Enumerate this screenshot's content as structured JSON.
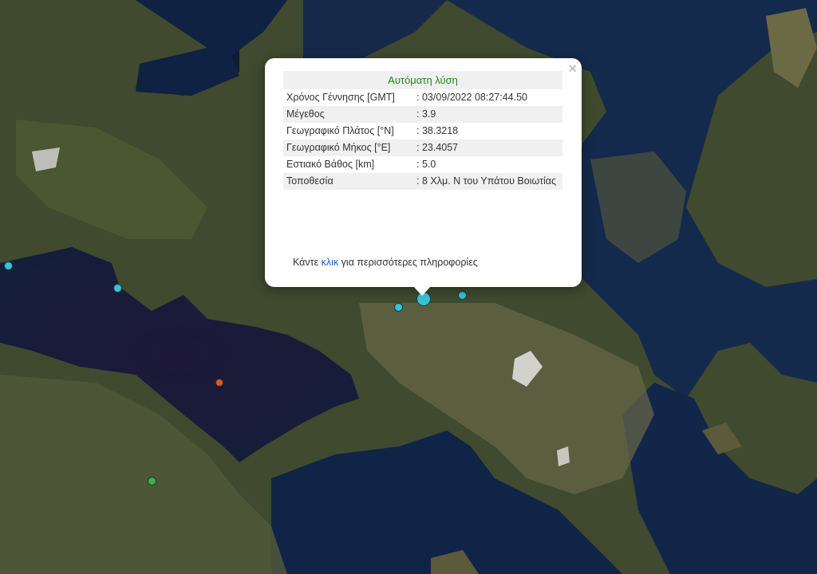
{
  "popup": {
    "title": "Αυτόματη λύση",
    "close_icon": "×",
    "rows": [
      {
        "label": "Χρόνος Γέννησης [GMT]",
        "value": ": 03/09/2022 08:27:44.50"
      },
      {
        "label": "Μέγεθος",
        "value": ": 3.9"
      },
      {
        "label": "Γεωγραφικό Πλάτος [°N]",
        "value": ": 38.3218"
      },
      {
        "label": "Γεωγραφικό Μήκος [°E]",
        "value": ": 23.4057"
      },
      {
        "label": "Εστιακό Βάθος [km]",
        "value": ": 5.0"
      },
      {
        "label": "Τοποθεσία",
        "value": ": 8 Χλμ. Ν του Υπάτου Βοιωτίας"
      }
    ],
    "more_prefix": "Κάντε",
    "more_link": "κλικ",
    "more_suffix": "για περισσότερες πληροφορίες"
  },
  "markers": [
    {
      "name": "selected-earthquake-marker",
      "color": "#39c3d2"
    },
    {
      "name": "earthquake-marker",
      "color": "#39c3d2"
    },
    {
      "name": "earthquake-marker",
      "color": "#39c3d2"
    },
    {
      "name": "earthquake-marker",
      "color": "#39c3d2"
    },
    {
      "name": "earthquake-marker",
      "color": "#39c3d2"
    },
    {
      "name": "earthquake-marker",
      "color": "#e05a1c"
    },
    {
      "name": "earthquake-marker",
      "color": "#3cb44b"
    }
  ]
}
